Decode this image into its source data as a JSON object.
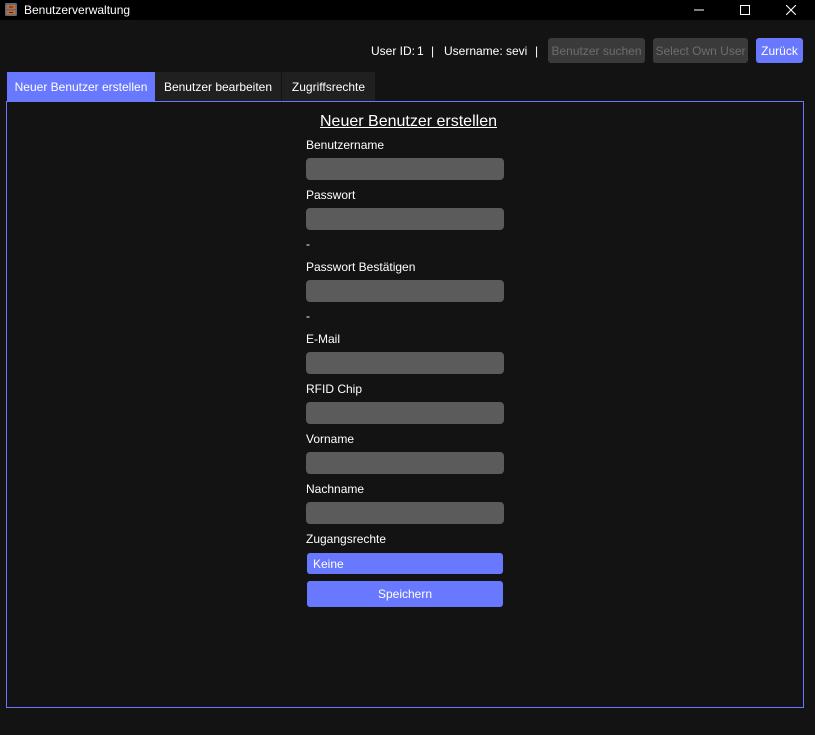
{
  "window": {
    "title": "Benutzerverwaltung",
    "icon": "folder-cabinet-icon",
    "controls": [
      "minimize-icon",
      "maximize-icon",
      "close-icon"
    ]
  },
  "header": {
    "user_id_label": "User ID:",
    "user_id_value": "1",
    "separator": "|",
    "username_label": "Username:",
    "username_value": "sevi",
    "buttons": {
      "search": "Benutzer suchen",
      "select_own": "Select Own User",
      "back": "Zurück"
    }
  },
  "tabs": [
    {
      "label": "Neuer Benutzer erstellen",
      "active": true
    },
    {
      "label": "Benutzer bearbeiten",
      "active": false
    },
    {
      "label": "Zugriffsrechte",
      "active": false
    }
  ],
  "form": {
    "title": "Neuer Benutzer erstellen",
    "fields": {
      "username": {
        "label": "Benutzername",
        "value": ""
      },
      "password": {
        "label": "Passwort",
        "value": "",
        "hint": "-"
      },
      "password_confirm": {
        "label": "Passwort Bestätigen",
        "value": "",
        "hint": "-"
      },
      "email": {
        "label": "E-Mail",
        "value": ""
      },
      "rfid": {
        "label": "RFID Chip",
        "value": ""
      },
      "firstname": {
        "label": "Vorname",
        "value": ""
      },
      "lastname": {
        "label": "Nachname",
        "value": ""
      }
    },
    "access": {
      "label": "Zugangsrechte",
      "selected": "Keine"
    },
    "save_label": "Speichern"
  },
  "colors": {
    "accent": "#6979ff",
    "background": "#131313",
    "titlebar": "#000000",
    "input": "#5b5b5b",
    "disabled_button": "#3a3a3a",
    "disabled_text": "#6d6d6d"
  }
}
